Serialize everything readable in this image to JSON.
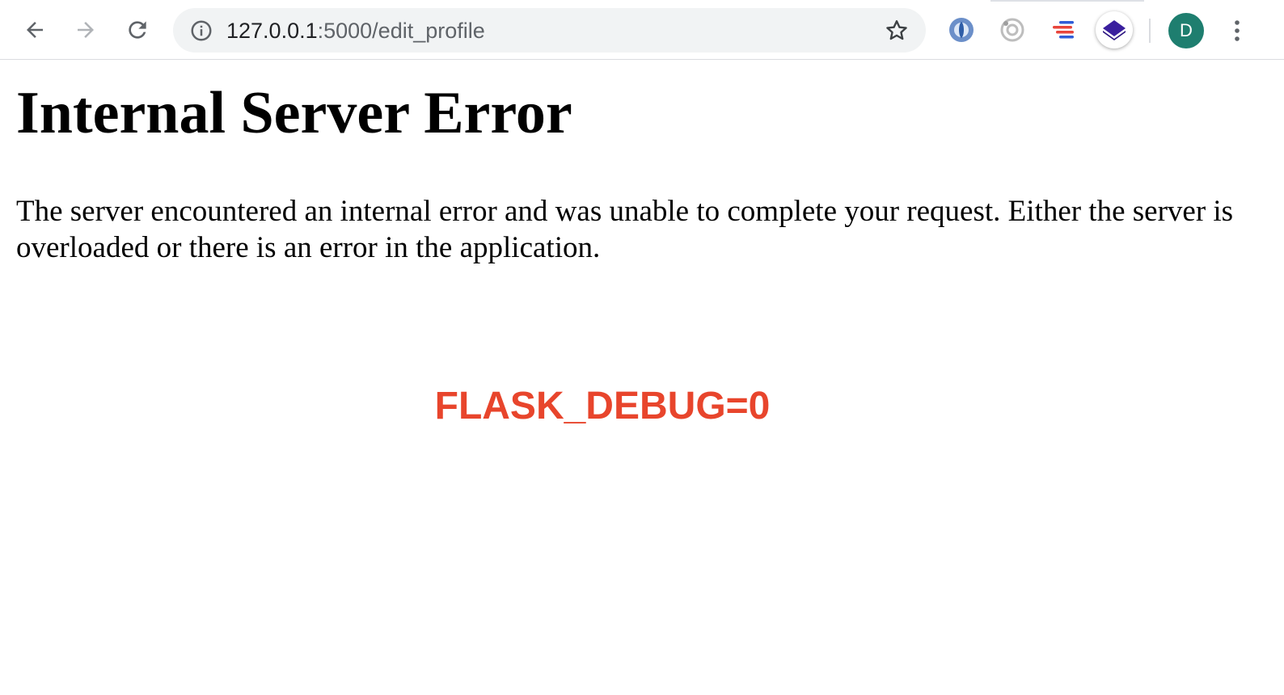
{
  "browser": {
    "url_host": "127.0.0.1",
    "url_path": ":5000/edit_profile",
    "profile_initial": "D",
    "icons": {
      "back": "back-arrow-icon",
      "forward": "forward-arrow-icon",
      "reload": "reload-icon",
      "site_info": "info-icon",
      "bookmark": "star-icon",
      "menu": "more-vert-icon"
    },
    "colors": {
      "avatar": "#1e7e6f",
      "omnibox": "#f1f3f4"
    }
  },
  "page": {
    "heading": "Internal Server Error",
    "message": "The server encountered an internal error and was unable to complete your request. Either the server is overloaded or there is an error in the application.",
    "annotation": "FLASK_DEBUG=0",
    "annotation_color": "#e8452c"
  }
}
